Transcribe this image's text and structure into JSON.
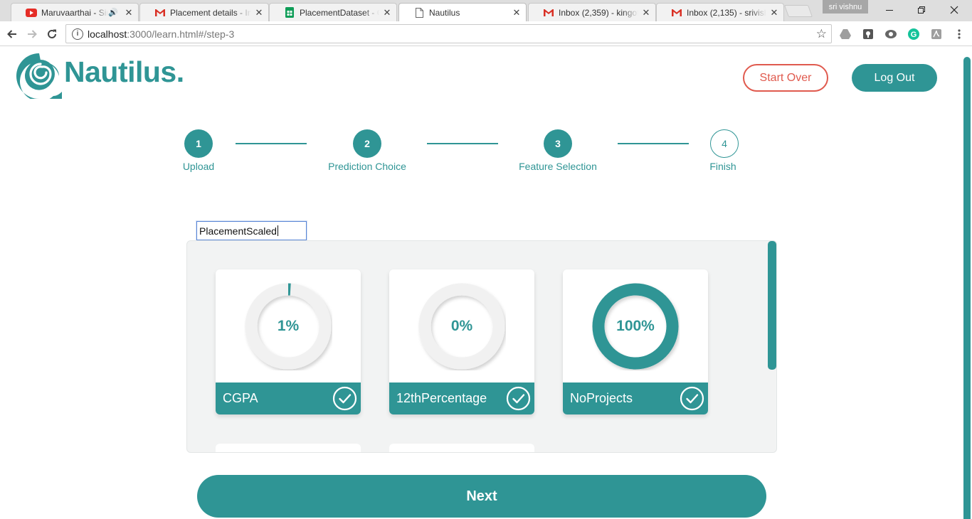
{
  "browser": {
    "tabs": [
      {
        "title": "Maruvaarthai - Sing",
        "icon": "youtube-icon",
        "audio": true
      },
      {
        "title": "Placement details - Inv",
        "icon": "gmail-icon"
      },
      {
        "title": "PlacementDataset - Go",
        "icon": "sheets-icon"
      },
      {
        "title": "Nautilus",
        "icon": "page-icon",
        "active": true
      },
      {
        "title": "Inbox (2,359) - kingofk",
        "icon": "gmail-icon"
      },
      {
        "title": "Inbox (2,135) - srivishn",
        "icon": "gmail-icon"
      }
    ],
    "profile_name": "sri vishnu",
    "url_host": "localhost",
    "url_path": ":3000/learn.html#/step-3"
  },
  "header": {
    "logo_text": "Nautilus.",
    "start_over_label": "Start Over",
    "logout_label": "Log Out"
  },
  "stepper": {
    "steps": [
      {
        "number": "1",
        "label": "Upload",
        "state": "done"
      },
      {
        "number": "2",
        "label": "Prediction Choice",
        "state": "done"
      },
      {
        "number": "3",
        "label": "Feature Selection",
        "state": "current"
      },
      {
        "number": "4",
        "label": "Finish",
        "state": "pending"
      }
    ]
  },
  "model_name_input": {
    "value": "PlacementScaled"
  },
  "features": [
    {
      "name": "CGPA",
      "percent_label": "1%",
      "percent": 1,
      "selected": true
    },
    {
      "name": "12thPercentage",
      "percent_label": "0%",
      "percent": 0,
      "selected": true
    },
    {
      "name": "NoProjects",
      "percent_label": "100%",
      "percent": 100,
      "selected": true
    }
  ],
  "next_label": "Next",
  "colors": {
    "primary": "#2f9595",
    "danger": "#e05a4e",
    "panel_bg": "#f2f3f3"
  }
}
